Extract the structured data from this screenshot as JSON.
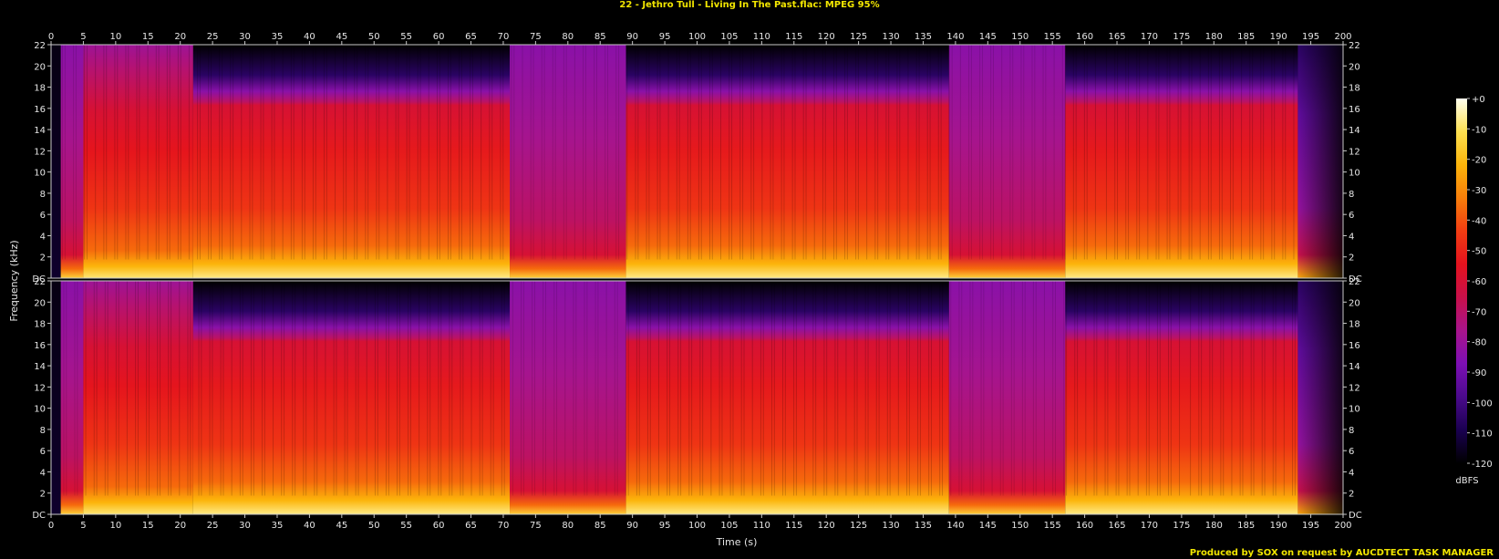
{
  "title": "22 - Jethro Tull - Living In The Past.flac: MPEG 95%",
  "credit": "Produced by SOX on request by AUCDTECT TASK MANAGER",
  "chart_data": {
    "type": "heatmap",
    "xlabel": "Time (s)",
    "ylabel": "Frequency (kHz)",
    "xlim": [
      0,
      200
    ],
    "ylim": [
      0,
      22
    ],
    "x_ticks": [
      "0",
      "5",
      "10",
      "15",
      "20",
      "25",
      "30",
      "35",
      "40",
      "45",
      "50",
      "55",
      "60",
      "65",
      "70",
      "75",
      "80",
      "85",
      "90",
      "95",
      "100",
      "105",
      "110",
      "115",
      "120",
      "125",
      "130",
      "135",
      "140",
      "145",
      "150",
      "155",
      "160",
      "165",
      "170",
      "175",
      "180",
      "185",
      "190",
      "195",
      "200"
    ],
    "y_ticks": [
      "DC",
      "2",
      "4",
      "6",
      "8",
      "10",
      "12",
      "14",
      "16",
      "18",
      "20",
      "22"
    ],
    "channels": 2,
    "colorbar": {
      "label": "dBFS",
      "ticks": [
        "+0",
        "-10",
        "-20",
        "-30",
        "-40",
        "-50",
        "-60",
        "-70",
        "-80",
        "-90",
        "-100",
        "-110",
        "-120"
      ],
      "range": [
        -120,
        0
      ],
      "colors": [
        "#000000",
        "#1a0050",
        "#4b0a8c",
        "#7d0fb4",
        "#a8148c",
        "#c8104a",
        "#e4121e",
        "#f23c12",
        "#f87e0a",
        "#fcb40a",
        "#fde050",
        "#fffff0"
      ]
    },
    "segments": [
      {
        "start": 0,
        "end": 1.5,
        "type": "silence"
      },
      {
        "start": 1.5,
        "end": 5,
        "type": "quiet"
      },
      {
        "start": 5,
        "end": 22,
        "type": "loud"
      },
      {
        "start": 22,
        "end": 71,
        "type": "loud_cut"
      },
      {
        "start": 71,
        "end": 89,
        "type": "quiet"
      },
      {
        "start": 89,
        "end": 139,
        "type": "loud_cut"
      },
      {
        "start": 139,
        "end": 157,
        "type": "quiet"
      },
      {
        "start": 157,
        "end": 193,
        "type": "loud_cut"
      },
      {
        "start": 193,
        "end": 200,
        "type": "fade"
      }
    ],
    "lowpass_cutoff_khz": 16.5
  }
}
